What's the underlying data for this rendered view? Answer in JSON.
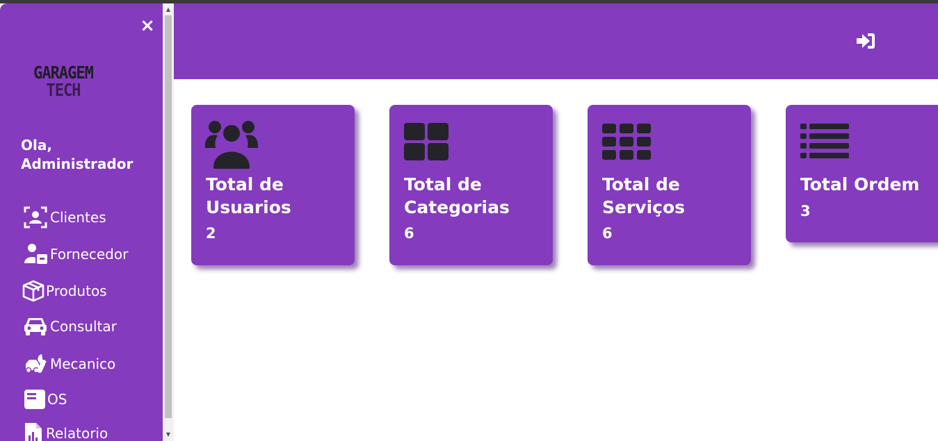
{
  "sidebar": {
    "close_symbol": "×",
    "logo": {
      "line1": "GARAGEM",
      "line2": "TECH"
    },
    "greeting_line1": "Ola,",
    "greeting_line2": "Administrador",
    "items": [
      {
        "label": "Clientes",
        "icon": "user-id-icon"
      },
      {
        "label": "Fornecedor",
        "icon": "user-box-icon"
      },
      {
        "label": "Produtos",
        "icon": "box-icon"
      },
      {
        "label": "Consultar",
        "icon": "car-icon"
      },
      {
        "label": "Mecanico",
        "icon": "car-wrench-icon"
      },
      {
        "label": "OS",
        "icon": "document-icon"
      },
      {
        "label": "Relatorio",
        "icon": "report-icon"
      }
    ]
  },
  "header": {
    "logout_icon": "sign-in-icon"
  },
  "cards": [
    {
      "title_line1": "Total de",
      "title_line2": "Usuarios",
      "value": "2",
      "icon": "users-icon"
    },
    {
      "title_line1": "Total de",
      "title_line2": "Categorias",
      "value": "6",
      "icon": "large-grid-icon"
    },
    {
      "title_line1": "Total de",
      "title_line2": "Serviços",
      "value": "6",
      "icon": "small-grid-icon"
    },
    {
      "title_line1": "Total Ordem",
      "title_line2": "",
      "value": "3",
      "icon": "list-icon"
    }
  ],
  "colors": {
    "purple": "#843bbd",
    "icon_dark": "#24232a",
    "white": "#ffffff"
  }
}
